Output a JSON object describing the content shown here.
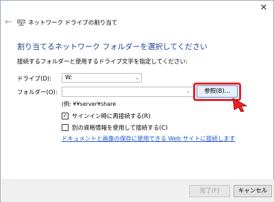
{
  "window": {
    "title": "ネットワーク ドライブの割り当て",
    "close_symbol": "✕",
    "back_symbol": "←"
  },
  "content": {
    "heading": "割り当てるネットワーク フォルダーを選択してください",
    "instruction": "接続するフォルダーと使用するドライブ文字を指定してください:"
  },
  "drive": {
    "label": "ドライブ(D):",
    "value": "W:"
  },
  "folder": {
    "label": "フォルダー(O):",
    "value": "",
    "browse_label": "参照(B)...",
    "example": "(例: ¥¥server¥share"
  },
  "options": {
    "reconnect": {
      "label": "サインイン時に再接続する(R)",
      "checked": true
    },
    "other_credentials": {
      "label": "別の資格情報を使用して接続する(C)",
      "checked": false
    }
  },
  "link": {
    "label": "ドキュメントと画像の保存に使用できる Web サイトに接続します"
  },
  "buttons": {
    "finish": "完了(F)",
    "cancel": "キャンセル"
  },
  "colors": {
    "heading": "#1e3f8a",
    "link": "#1a55c9",
    "highlight": "#e8212b",
    "primary_button_border": "#5a88c6"
  },
  "icons": {
    "back": "arrow-left-icon",
    "window": "network-drive-icon",
    "close": "close-icon",
    "cursor": "pointer-cursor-icon"
  }
}
